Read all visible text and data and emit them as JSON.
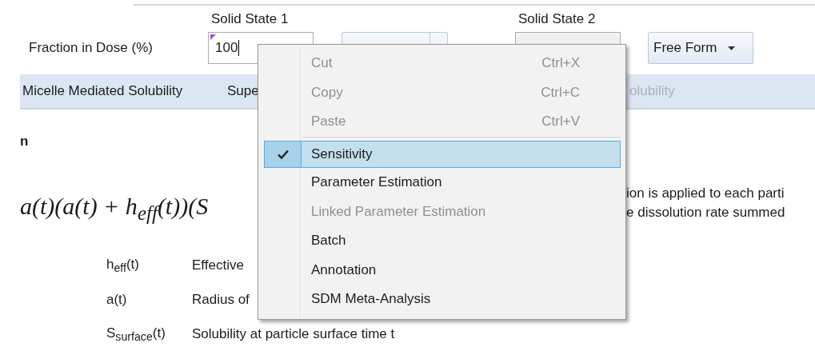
{
  "dose_row": {
    "label": "Fraction in Dose (%)",
    "state_1": {
      "header": "Solid State 1",
      "value": "100",
      "focused": true,
      "disabled": false
    },
    "form_1": {
      "kind": "split"
    },
    "state_2": {
      "header": "Solid State 2",
      "focused": false,
      "disabled": true
    },
    "form_2": {
      "kind": "dropdown",
      "value": "Free Form"
    }
  },
  "tabs": [
    {
      "label": "Micelle Mediated Solubility",
      "disabled": false
    },
    {
      "label": "Supe",
      "disabled": false
    },
    {
      "label": "olubility",
      "disabled": true
    }
  ],
  "section_heading": "n",
  "equation": "a(t)(a(t) + h$_{eff}$(t))(S",
  "description_lines": [
    "ion is applied to each parti",
    "e dissolution rate summed"
  ],
  "definitions": [
    {
      "symbol": "h$_{eff}$(t)",
      "text": "Effective"
    },
    {
      "symbol": "a(t)",
      "text": "Radius of"
    },
    {
      "symbol": "S$_{surface}$(t)",
      "text": "Solubility at particle surface time t"
    }
  ],
  "context_menu": {
    "items": [
      {
        "kind": "command",
        "label": "Cut",
        "shortcut": "Ctrl+X",
        "disabled": true,
        "checked": false,
        "selected": false
      },
      {
        "kind": "command",
        "label": "Copy",
        "shortcut": "Ctrl+C",
        "disabled": true,
        "checked": false,
        "selected": false
      },
      {
        "kind": "command",
        "label": "Paste",
        "shortcut": "Ctrl+V",
        "disabled": true,
        "checked": false,
        "selected": false
      },
      {
        "kind": "separator"
      },
      {
        "kind": "command",
        "label": "Sensitivity",
        "disabled": false,
        "checked": true,
        "selected": true
      },
      {
        "kind": "command",
        "label": "Parameter Estimation",
        "disabled": false,
        "checked": false,
        "selected": false
      },
      {
        "kind": "command",
        "label": "Linked Parameter Estimation",
        "disabled": true,
        "checked": false,
        "selected": false
      },
      {
        "kind": "command",
        "label": "Batch",
        "disabled": false,
        "checked": false,
        "selected": false
      },
      {
        "kind": "command",
        "label": "Annotation",
        "disabled": false,
        "checked": false,
        "selected": false
      },
      {
        "kind": "command",
        "label": "SDM Meta-Analysis",
        "disabled": false,
        "checked": false,
        "selected": false
      }
    ]
  }
}
